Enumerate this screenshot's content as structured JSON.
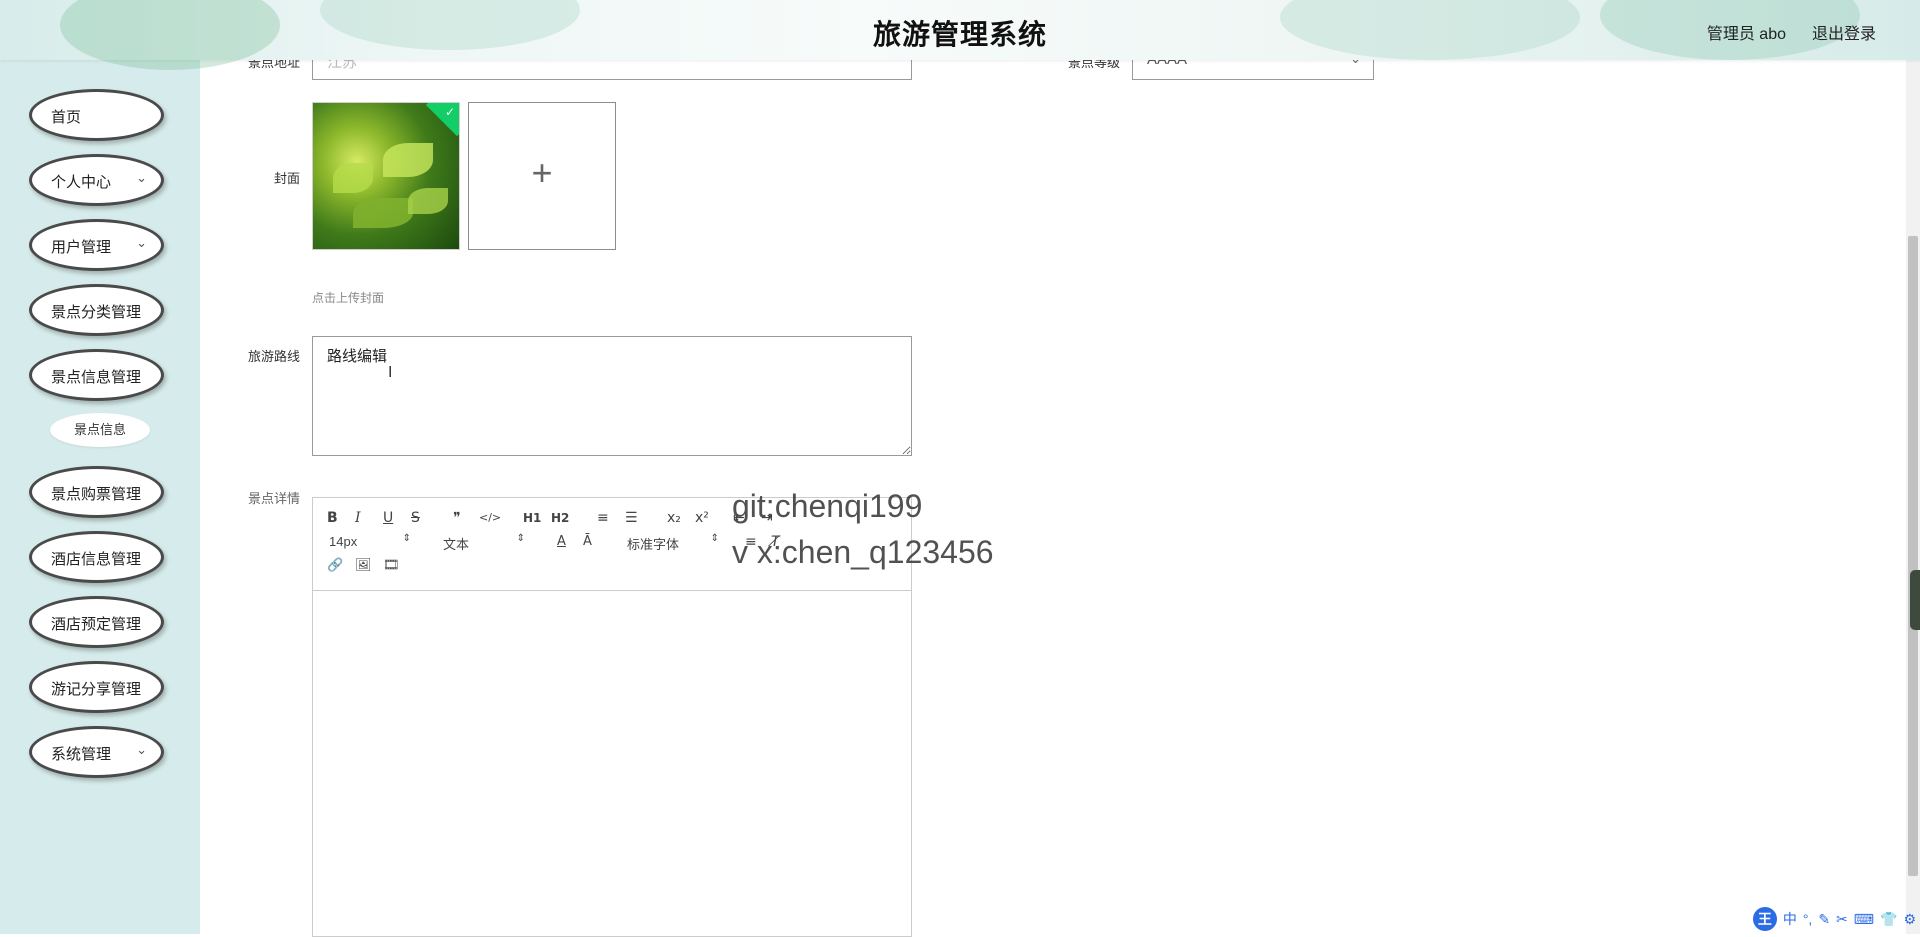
{
  "header": {
    "title": "旅游管理系统",
    "user_label": "管理员 abo",
    "logout_label": "退出登录"
  },
  "sidebar": {
    "items": [
      {
        "label": "首页",
        "has_children": false
      },
      {
        "label": "个人中心",
        "has_children": true
      },
      {
        "label": "用户管理",
        "has_children": true
      },
      {
        "label": "景点分类管理",
        "has_children": false
      },
      {
        "label": "景点信息管理",
        "has_children": false
      },
      {
        "label": "景点购票管理",
        "has_children": false
      },
      {
        "label": "酒店信息管理",
        "has_children": false
      },
      {
        "label": "酒店预定管理",
        "has_children": false
      },
      {
        "label": "游记分享管理",
        "has_children": false
      },
      {
        "label": "系统管理",
        "has_children": true
      }
    ],
    "sub_item": "景点信息",
    "chevron": "⌄"
  },
  "form": {
    "address_label": "景点地址",
    "address_value": "江苏",
    "level_label": "景点等级",
    "level_value": "AAAA",
    "cover_label": "封面",
    "upload_tip": "点击上传封面",
    "route_label": "旅游路线",
    "route_value": "路线编辑",
    "detail_label": "景点详情"
  },
  "editor_toolbar": {
    "row1": [
      "B",
      "I",
      "U",
      "S",
      "❞",
      "</>",
      "H1",
      "H2",
      "≡",
      "☰",
      "x₂",
      "x²"
    ],
    "row1_extra": [
      "⇤",
      "⇥"
    ],
    "font_size": "14px",
    "text_type": "文本",
    "font_family": "标准字体",
    "row2_icons": [
      "A",
      "Ā",
      "≡",
      "T̸"
    ],
    "row3_icons": [
      "🔗",
      "🖼",
      "🎞"
    ]
  },
  "watermark": {
    "line1": "git:chenqi199",
    "line2": "v x:chen_q123456"
  },
  "ime": {
    "logo": "王",
    "items": [
      "中",
      "°,",
      "✎",
      "✂",
      "⌨",
      "👕",
      "⚙"
    ]
  },
  "colors": {
    "sidebar_bg": "#d6ebeb",
    "accent_check": "#13ce66",
    "ime_blue": "#2b6be6"
  }
}
